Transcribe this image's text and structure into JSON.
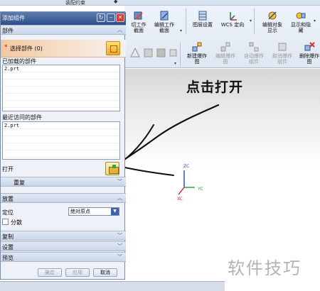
{
  "top_strip": {
    "label": "装配约束",
    "chevron": "◆"
  },
  "dialog": {
    "title": "添加组件",
    "buttons": {
      "restore": "↻",
      "minimize": "–",
      "close": "✕"
    },
    "sections": {
      "part": {
        "label": "部件",
        "collapse_icon": "︿"
      },
      "repeat": {
        "label": "重复",
        "collapse_icon": "﹀"
      },
      "placement": {
        "label": "放置",
        "collapse_icon": "︿"
      },
      "copy": {
        "label": "复制",
        "collapse_icon": "﹀"
      },
      "settings": {
        "label": "设置",
        "collapse_icon": "﹀"
      },
      "preview": {
        "label": "预览",
        "collapse_icon": "﹀"
      }
    },
    "select_part": {
      "star": "*",
      "label": "选择部件 (0)"
    },
    "loaded_parts": {
      "label": "已加载的部件",
      "items": [
        "2.prt",
        "",
        "",
        "",
        "",
        ""
      ]
    },
    "recent_parts": {
      "label": "最近访问的部件",
      "items": [
        "2.prt",
        "",
        "",
        "",
        ""
      ]
    },
    "open": {
      "label": "打开"
    },
    "placement_field": {
      "label": "定位",
      "value": "绝对原点",
      "dropdown_icon": "▼"
    },
    "scatter": {
      "label": "分散"
    },
    "footer": {
      "ok": "确定",
      "apply": "应用",
      "cancel": "取消"
    }
  },
  "ribbon": {
    "buttons": [
      {
        "label": "切工作\n截面",
        "enabled": true
      },
      {
        "label": "编辑工作\n截面",
        "enabled": true
      },
      {
        "label": "图层设置",
        "enabled": true
      },
      {
        "label": "WCS 定向",
        "enabled": true
      },
      {
        "label": "编辑对象\n显示",
        "enabled": true
      },
      {
        "label": "显示和隐\n藏",
        "enabled": true
      },
      {
        "label": "新建爆炸\n图",
        "enabled": true
      },
      {
        "label": "编辑爆炸\n图",
        "enabled": false
      },
      {
        "label": "自动爆炸\n组件",
        "enabled": false
      },
      {
        "label": "取消爆炸\n组件",
        "enabled": false
      },
      {
        "label": "删除爆炸\n图",
        "enabled": true
      }
    ]
  },
  "canvas": {
    "annotation": "点击打开",
    "triad": {
      "zc": "ZC",
      "yc": "YC",
      "xc": "XC"
    },
    "watermark": "软件技巧"
  }
}
